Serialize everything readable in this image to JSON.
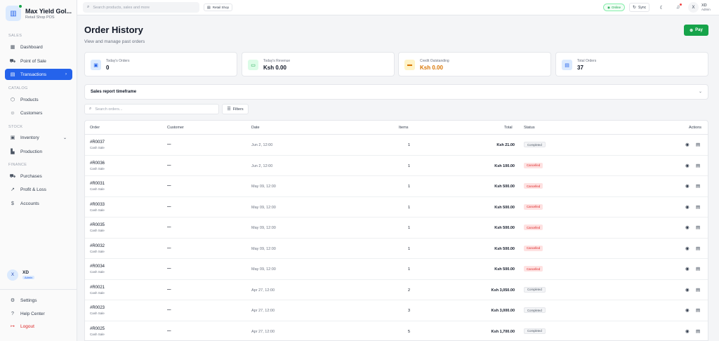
{
  "brand": {
    "name": "Max Yield Gol...",
    "subtitle": "Retail Shop POS"
  },
  "sidebar": {
    "sections": {
      "sales": "SALES",
      "catalog": "CATALOG",
      "stock": "STOCK",
      "finance": "FINANCE"
    },
    "items": {
      "dashboard": "Dashboard",
      "pos": "Point of Sale",
      "transactions": "Transactions",
      "products": "Products",
      "customers": "Customers",
      "inventory": "Inventory",
      "production": "Production",
      "purchases": "Purchases",
      "profit_loss": "Profit & Loss",
      "accounts": "Accounts"
    },
    "user": {
      "initial": "X",
      "name": "XD",
      "role": "Admin"
    },
    "footer": {
      "settings": "Settings",
      "help": "Help Center",
      "logout": "Logout"
    }
  },
  "topbar": {
    "search_placeholder": "Search products, sales and more",
    "shop": "Retail Shop",
    "status": "Online",
    "sync": "Sync",
    "user": {
      "initial": "X",
      "name": "XD",
      "role": "Admin"
    }
  },
  "page": {
    "title": "Order History",
    "subtitle": "View and manage past orders",
    "pay_label": "Pay"
  },
  "stats": {
    "todays_orders": {
      "label": "Today's Orders",
      "value": "0"
    },
    "todays_revenue": {
      "label": "Today's Revenue",
      "value": "Ksh 0.00"
    },
    "credit_outstanding": {
      "label": "Credit Outstanding",
      "value": "Ksh 0.00"
    },
    "total_orders": {
      "label": "Total Orders",
      "value": "37"
    }
  },
  "timeframe": {
    "label": "Sales report timeframe"
  },
  "orders_search": {
    "placeholder": "Search orders...",
    "filters_label": "Filters"
  },
  "table": {
    "headers": {
      "order": "Order",
      "customer": "Customer",
      "date": "Date",
      "items": "Items",
      "total": "Total",
      "status": "Status",
      "actions": "Actions"
    },
    "rows": [
      {
        "id": "#R0037",
        "type": "Cash Sale",
        "customer": "—",
        "date": "Jun 2, 12:00",
        "items": "1",
        "total": "Ksh 21.00",
        "status": "Completed"
      },
      {
        "id": "#R0036",
        "type": "Cash Sale",
        "customer": "—",
        "date": "Jun 2, 12:00",
        "items": "1",
        "total": "Ksh 100.00",
        "status": "Cancelled"
      },
      {
        "id": "#R0031",
        "type": "Cash Sale",
        "customer": "—",
        "date": "May 09, 12:00",
        "items": "1",
        "total": "Ksh 500.00",
        "status": "Cancelled"
      },
      {
        "id": "#R0033",
        "type": "Cash Sale",
        "customer": "—",
        "date": "May 09, 12:00",
        "items": "1",
        "total": "Ksh 500.00",
        "status": "Cancelled"
      },
      {
        "id": "#R0035",
        "type": "Cash Sale",
        "customer": "—",
        "date": "May 09, 12:00",
        "items": "1",
        "total": "Ksh 500.00",
        "status": "Cancelled"
      },
      {
        "id": "#R0032",
        "type": "Cash Sale",
        "customer": "—",
        "date": "May 09, 12:00",
        "items": "1",
        "total": "Ksh 500.00",
        "status": "Cancelled"
      },
      {
        "id": "#R0034",
        "type": "Cash Sale",
        "customer": "—",
        "date": "May 09, 12:00",
        "items": "1",
        "total": "Ksh 500.00",
        "status": "Cancelled"
      },
      {
        "id": "#R0021",
        "type": "Cash Sale",
        "customer": "—",
        "date": "Apr 27, 12:00",
        "items": "2",
        "total": "Ksh 3,050.00",
        "status": "Completed"
      },
      {
        "id": "#R0023",
        "type": "Cash Sale",
        "customer": "—",
        "date": "Apr 27, 12:00",
        "items": "3",
        "total": "Ksh 3,000.00",
        "status": "Completed"
      },
      {
        "id": "#R0025",
        "type": "Cash Sale",
        "customer": "—",
        "date": "Apr 27, 12:00",
        "items": "5",
        "total": "Ksh 1,700.00",
        "status": "Completed"
      }
    ]
  },
  "colors": {
    "primary": "#2563eb",
    "success": "#16a34a",
    "danger": "#dc2626",
    "warning": "#d97706"
  }
}
